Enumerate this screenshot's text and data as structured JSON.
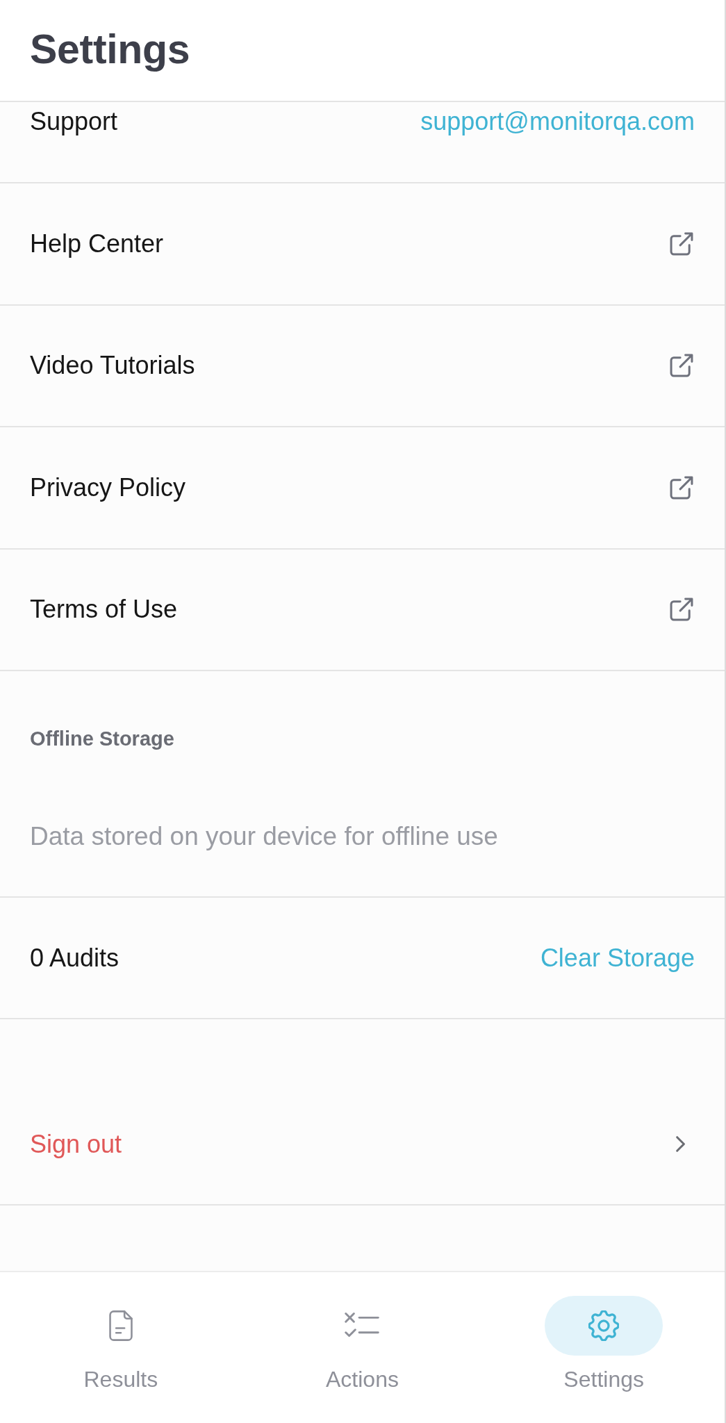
{
  "header": {
    "title": "Settings"
  },
  "support": {
    "label": "Support",
    "email": "support@monitorqa.com"
  },
  "links": [
    {
      "label": "Help Center"
    },
    {
      "label": "Video Tutorials"
    },
    {
      "label": "Privacy Policy"
    },
    {
      "label": "Terms of Use"
    }
  ],
  "offline_storage": {
    "heading": "Offline Storage",
    "description": "Data stored on your device for offline use",
    "count": "0 Audits",
    "action": "Clear Storage"
  },
  "sign_out": {
    "label": "Sign out"
  },
  "bottom_nav": [
    {
      "label": "Results",
      "selected": false
    },
    {
      "label": "Actions",
      "selected": false
    },
    {
      "label": "Settings",
      "selected": true
    }
  ]
}
